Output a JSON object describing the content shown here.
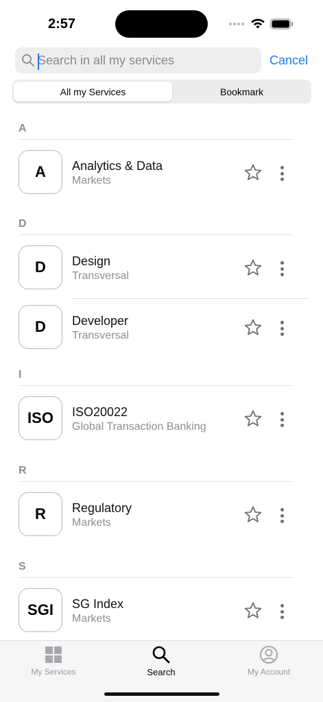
{
  "status_bar": {
    "time": "2:57",
    "icons": [
      "signal-dots-icon",
      "wifi-icon",
      "battery-icon"
    ]
  },
  "search": {
    "placeholder": "Search in all my services",
    "value": "",
    "cancel_label": "Cancel"
  },
  "segments": [
    {
      "label": "All my Services",
      "selected": true
    },
    {
      "label": "Bookmark",
      "selected": false
    }
  ],
  "sections": [
    {
      "letter": "A",
      "items": [
        {
          "badge": "A",
          "title": "Analytics & Data",
          "subtitle": "Markets"
        }
      ]
    },
    {
      "letter": "D",
      "items": [
        {
          "badge": "D",
          "title": "Design",
          "subtitle": "Transversal"
        },
        {
          "badge": "D",
          "title": "Developer",
          "subtitle": "Transversal"
        }
      ]
    },
    {
      "letter": "I",
      "items": [
        {
          "badge": "ISO",
          "title": "ISO20022",
          "subtitle": "Global Transaction Banking"
        }
      ]
    },
    {
      "letter": "R",
      "items": [
        {
          "badge": "R",
          "title": "Regulatory",
          "subtitle": "Markets"
        }
      ]
    },
    {
      "letter": "S",
      "items": [
        {
          "badge": "SGI",
          "title": "SG Index",
          "subtitle": "Markets"
        }
      ]
    }
  ],
  "tab_bar": [
    {
      "label": "My Services",
      "icon": "grid-icon",
      "active": false
    },
    {
      "label": "Search",
      "icon": "search-icon",
      "active": true
    },
    {
      "label": "My Account",
      "icon": "account-icon",
      "active": false
    }
  ],
  "colors": {
    "accent": "#1b7cf2",
    "secondary_text": "#8e8e93",
    "divider": "#e2e2e4"
  }
}
